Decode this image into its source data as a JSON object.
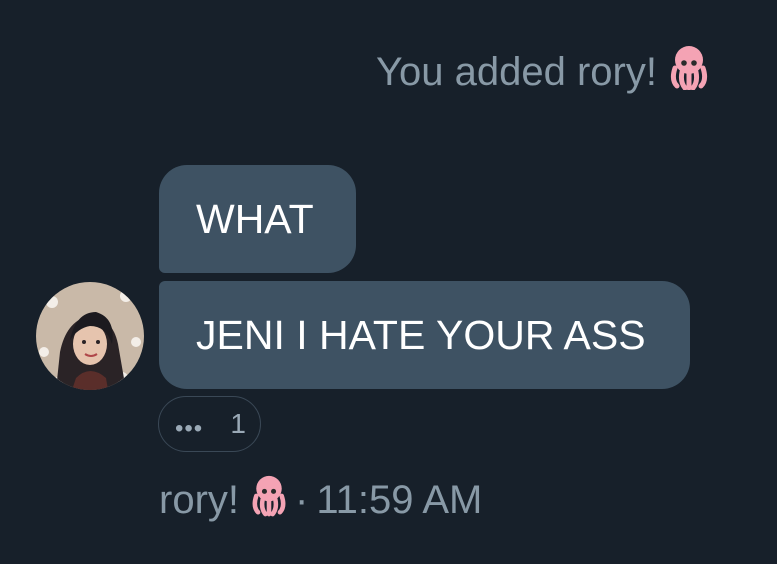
{
  "system_message": {
    "text": "You added rory!",
    "emoji": "octopus-icon"
  },
  "messages": [
    {
      "text": "WHAT"
    },
    {
      "text": "JENI I HATE YOUR ASS"
    }
  ],
  "reaction": {
    "icon": "ellipsis",
    "count": "1"
  },
  "sender": {
    "name": "rory!",
    "emoji": "octopus-icon",
    "separator": "·",
    "time": "11:59 AM"
  },
  "colors": {
    "background": "#17202a",
    "bubble": "#3e5263",
    "muted_text": "#8899a6",
    "octopus": "#f4a3b4"
  }
}
